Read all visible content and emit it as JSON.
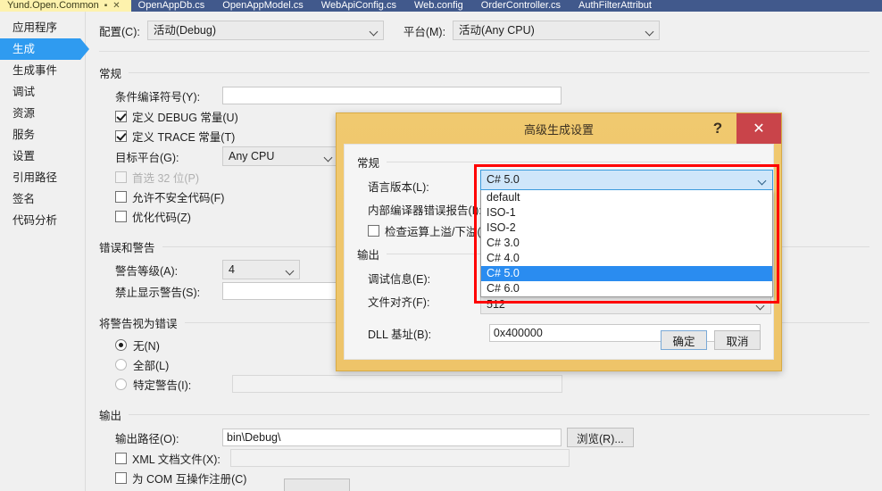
{
  "tabs": [
    {
      "label": "Yund.Open.Common",
      "active": true,
      "pin": "▪",
      "close": "✕"
    },
    {
      "label": "OpenAppDb.cs",
      "active": false
    },
    {
      "label": "OpenAppModel.cs",
      "active": false
    },
    {
      "label": "WebApiConfig.cs",
      "active": false
    },
    {
      "label": "Web.config",
      "active": false
    },
    {
      "label": "OrderController.cs",
      "active": false
    },
    {
      "label": "AuthFilterAttribut",
      "active": false
    }
  ],
  "sidebar": {
    "items": [
      {
        "label": "应用程序",
        "selected": false
      },
      {
        "label": "生成",
        "selected": true
      },
      {
        "label": "生成事件",
        "selected": false
      },
      {
        "label": "调试",
        "selected": false
      },
      {
        "label": "资源",
        "selected": false
      },
      {
        "label": "服务",
        "selected": false
      },
      {
        "label": "设置",
        "selected": false
      },
      {
        "label": "引用路径",
        "selected": false
      },
      {
        "label": "签名",
        "selected": false
      },
      {
        "label": "代码分析",
        "selected": false
      }
    ]
  },
  "top": {
    "config_label": "配置(C):",
    "config_value": "活动(Debug)",
    "platform_label": "平台(M):",
    "platform_value": "活动(Any CPU)"
  },
  "general": {
    "title": "常规",
    "cond_symbols_label": "条件编译符号(Y):",
    "cond_symbols_value": "",
    "define_debug": "定义 DEBUG 常量(U)",
    "define_debug_checked": true,
    "define_trace": "定义 TRACE 常量(T)",
    "define_trace_checked": true,
    "target_platform_label": "目标平台(G):",
    "target_platform_value": "Any CPU",
    "prefer32_label": "首选 32 位(P)",
    "prefer32_checked": false,
    "unsafe_label": "允许不安全代码(F)",
    "unsafe_checked": false,
    "optimize_label": "优化代码(Z)",
    "optimize_checked": false
  },
  "errors": {
    "title": "错误和警告",
    "warn_level_label": "警告等级(A):",
    "warn_level_value": "4",
    "suppress_label": "禁止显示警告(S):",
    "suppress_value": ""
  },
  "warn_as_error": {
    "title": "将警告视为错误",
    "none_label": "无(N)",
    "all_label": "全部(L)",
    "specific_label": "特定警告(I):",
    "specific_value": "",
    "selected": "none"
  },
  "output": {
    "title": "输出",
    "path_label": "输出路径(O):",
    "path_value": "bin\\Debug\\",
    "browse_label": "浏览(R)...",
    "xmldoc_label": "XML 文档文件(X):",
    "xmldoc_checked": false,
    "xmldoc_value": "",
    "com_label": "为 COM 互操作注册(C)",
    "com_checked": false
  },
  "dialog": {
    "title": "高级生成设置",
    "help_glyph": "?",
    "close_glyph": "✕",
    "general_title": "常规",
    "lang_version_label": "语言版本(L):",
    "lang_version_value": "C# 5.0",
    "lang_version_options": [
      "default",
      "ISO-1",
      "ISO-2",
      "C# 3.0",
      "C# 4.0",
      "C# 5.0",
      "C# 6.0"
    ],
    "lang_version_selected": "C# 5.0",
    "internal_error_label": "内部编译器错误报告(I):",
    "internal_error_value": "",
    "overflow_label": "检查运算上溢/下溢(K",
    "overflow_checked": false,
    "output_title": "输出",
    "debug_info_label": "调试信息(E):",
    "debug_info_value": "",
    "file_align_label": "文件对齐(F):",
    "file_align_value": "512",
    "dll_base_label": "DLL 基址(B):",
    "dll_base_value": "0x400000",
    "ok_label": "确定",
    "cancel_label": "取消"
  },
  "colors": {
    "dialog_frame": "#f0c96f",
    "close_button": "#c9444a",
    "accent_blue": "#2f9bf0",
    "selection_blue": "#2a8cf0",
    "highlight_red": "#ff0000",
    "tabstrip": "#41598c",
    "active_tab": "#fdf2ad"
  }
}
